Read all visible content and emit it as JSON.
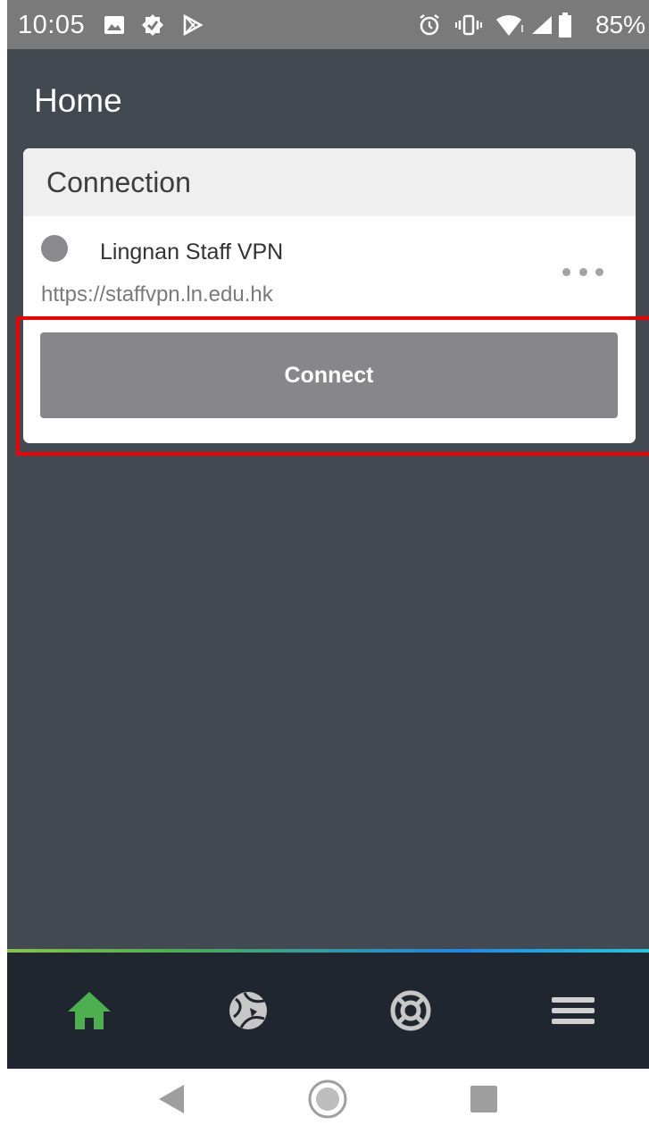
{
  "status_bar": {
    "time": "10:05",
    "battery": "85%",
    "icons": [
      "image-icon",
      "verified-icon",
      "play-store-icon",
      "alarm-icon",
      "vibrate-icon",
      "wifi-icon",
      "signal-icon",
      "battery-icon"
    ]
  },
  "page": {
    "title": "Home"
  },
  "connection_card": {
    "header": "Connection",
    "status_color": "#8a8a8e",
    "vpn_name": "Lingnan Staff VPN",
    "vpn_url": "https://staffvpn.ln.edu.hk",
    "connect_label": "Connect"
  },
  "highlight_color": "#f00000",
  "bottom_nav": {
    "items": [
      "home-icon",
      "globe-icon",
      "lifebuoy-icon",
      "menu-icon"
    ],
    "active": "home-icon",
    "active_color": "#4caf50"
  },
  "system_nav": [
    "back-icon",
    "home-circle-icon",
    "recents-icon"
  ]
}
